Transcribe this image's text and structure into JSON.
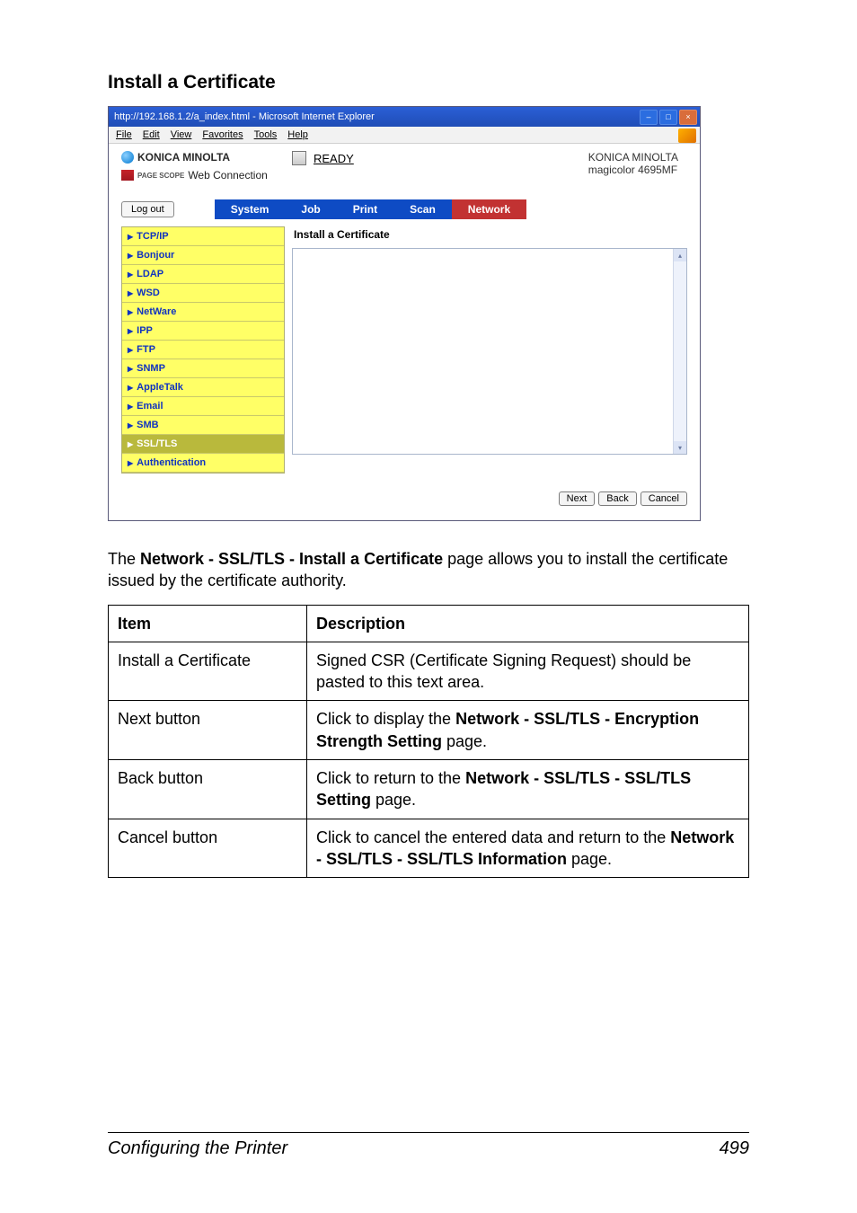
{
  "section_title": "Install a Certificate",
  "browser": {
    "title": "http://192.168.1.2/a_index.html - Microsoft Internet Explorer",
    "menu": [
      "File",
      "Edit",
      "View",
      "Favorites",
      "Tools",
      "Help"
    ],
    "brand_line1": "KONICA MINOLTA",
    "pagescope_pre": "PAGE SCOPE",
    "brand_line2": "Web Connection",
    "ready": "READY",
    "model_line1": "KONICA MINOLTA",
    "model_line2": "magicolor 4695MF",
    "logout": "Log out",
    "tabs": [
      "System",
      "Job",
      "Print",
      "Scan",
      "Network"
    ],
    "active_tab_index": 4,
    "nav_items": [
      "TCP/IP",
      "Bonjour",
      "LDAP",
      "WSD",
      "NetWare",
      "IPP",
      "FTP",
      "SNMP",
      "AppleTalk",
      "Email",
      "SMB",
      "SSL/TLS",
      "Authentication"
    ],
    "nav_current_index": 11,
    "panel_title": "Install a Certificate",
    "buttons": {
      "next": "Next",
      "back": "Back",
      "cancel": "Cancel"
    }
  },
  "body_paragraph_pre": "The ",
  "body_paragraph_bold": "Network - SSL/TLS - Install a Certificate",
  "body_paragraph_post": " page allows you to install the certificate issued by the certificate authority.",
  "table": {
    "headers": {
      "item": "Item",
      "desc": "Description"
    },
    "rows": [
      {
        "item": "Install a Certificate",
        "desc_pre": "Signed CSR (Certificate Signing Request) should be pasted to this text area.",
        "desc_bold": "",
        "desc_post": ""
      },
      {
        "item": "Next button",
        "desc_pre": "Click to display the ",
        "desc_bold": "Network - SSL/TLS - Encryption Strength Setting",
        "desc_post": " page."
      },
      {
        "item": "Back button",
        "desc_pre": "Click to return to the ",
        "desc_bold": "Network - SSL/TLS - SSL/TLS Setting",
        "desc_post": " page."
      },
      {
        "item": "Cancel button",
        "desc_pre": "Click to cancel the entered data and return to the ",
        "desc_bold": "Network - SSL/TLS - SSL/TLS Information",
        "desc_post": " page."
      }
    ]
  },
  "footer": {
    "left": "Configuring the Printer",
    "right": "499"
  }
}
